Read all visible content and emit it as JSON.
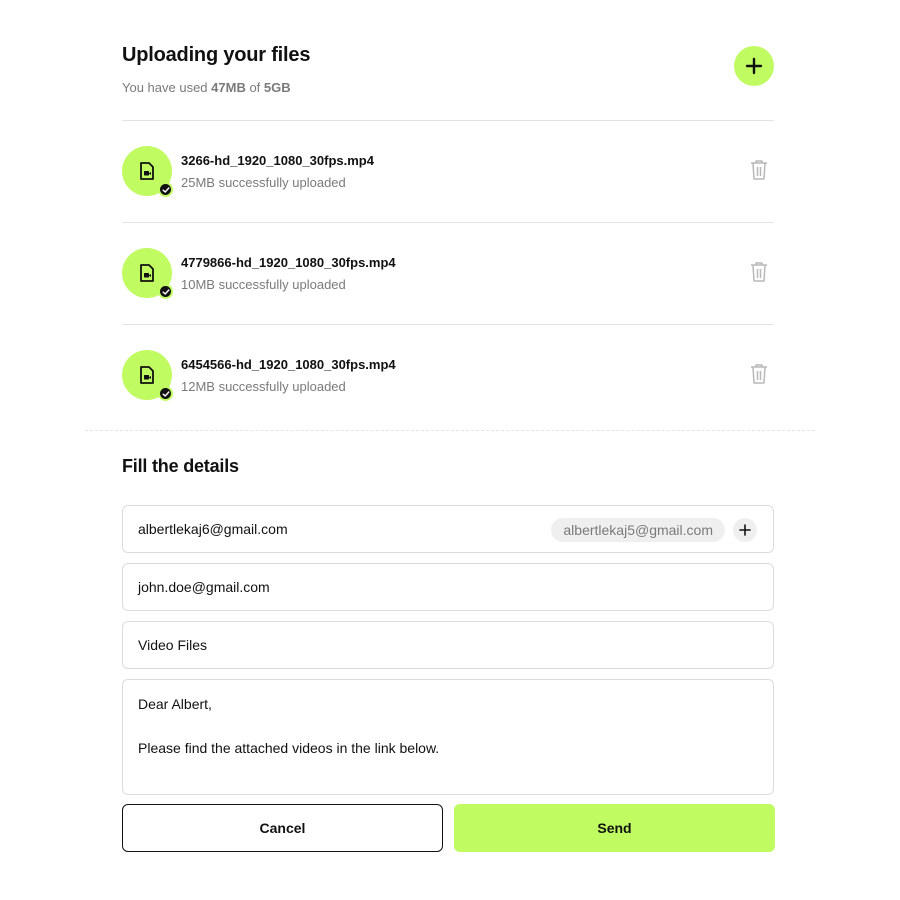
{
  "header": {
    "title": "Uploading your files",
    "usage_prefix": "You have used ",
    "usage_used": "47MB",
    "usage_mid": " of ",
    "usage_total": "5GB"
  },
  "files": [
    {
      "name": "3266-hd_1920_1080_30fps.mp4",
      "status": "25MB successfully uploaded"
    },
    {
      "name": "4779866-hd_1920_1080_30fps.mp4",
      "status": "10MB successfully uploaded"
    },
    {
      "name": "6454566-hd_1920_1080_30fps.mp4",
      "status": "12MB successfully uploaded"
    }
  ],
  "details": {
    "title": "Fill the details",
    "from_value": "albertlekaj6@gmail.com",
    "cc_chip": "albertlekaj5@gmail.com",
    "to_value": "john.doe@gmail.com",
    "subject_value": "Video Files",
    "message_line1": "Dear Albert,",
    "message_line2": "Please find the attached videos in the link below."
  },
  "actions": {
    "cancel_label": "Cancel",
    "send_label": "Send"
  },
  "colors": {
    "accent": "#c0fb61",
    "text": "#111111",
    "muted": "#7a7a7a",
    "border": "#dcdcdc"
  },
  "icons": {
    "add": "plus-icon",
    "file": "video-file-icon",
    "uploaded": "check-icon",
    "delete": "trash-icon"
  }
}
